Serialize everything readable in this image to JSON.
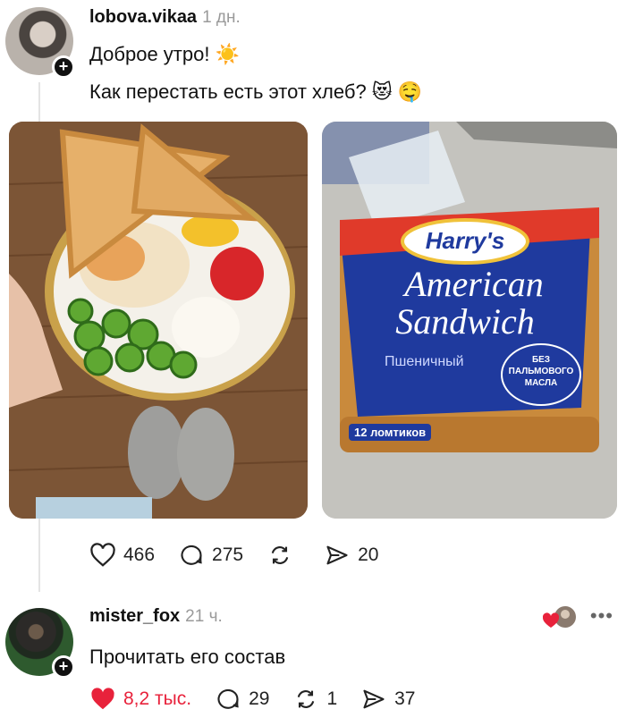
{
  "post": {
    "username": "lobova.vikaa",
    "time": "1 дн.",
    "line1": "Доброе утро! ☀️",
    "line2": "Как перестать есть этот хлеб? 😻 🤤",
    "bread_pack": {
      "brand": "Harry's",
      "product_line1": "American",
      "product_line2": "Sandwich",
      "variant": "Пшеничный",
      "badge_line1": "БЕЗ",
      "badge_line2": "ПАЛЬМОВОГО",
      "badge_line3": "МАСЛА",
      "slices": "12 ломтиков"
    },
    "likes": "466",
    "comments": "275",
    "shares": "20"
  },
  "reply": {
    "username": "mister_fox",
    "time": "21 ч.",
    "text": "Прочитать его состав",
    "likes": "8,2 тыс.",
    "comments": "29",
    "reposts": "1",
    "shares": "37"
  },
  "colors": {
    "like_red": "#e8223b",
    "pack_blue": "#1f3a9e",
    "pack_red": "#e03a2a"
  }
}
